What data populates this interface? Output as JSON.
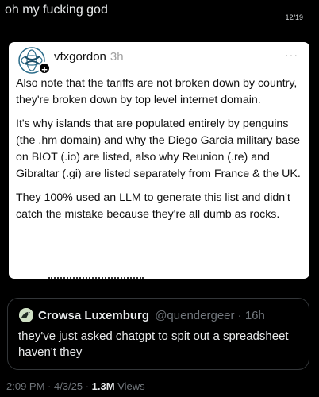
{
  "header": {
    "title": "oh my fucking god",
    "page_counter": "12/19"
  },
  "quoted_post": {
    "username": "vfxgordon",
    "time": "3h",
    "more": "···",
    "avatar_plus": "+",
    "paragraphs": [
      "Also note that the tariffs are not broken down by country, they're broken down by top level internet domain.",
      "It's why islands that are populated entirely by penguins (the .hm domain) and why the Diego Garcia military base on BIOT (.io) are listed, also why Reunion (.re) and Gibraltar (.gi) are listed separately from France & the UK.",
      "They 100% used an LLM to generate this list and didn't catch the mistake because they're all dumb as rocks."
    ]
  },
  "reply": {
    "name": "Crowsa Luxemburg",
    "handle": "@quendergeer · 16h",
    "text": "they've just asked chatgpt to spit out a spreadsheet haven't they"
  },
  "meta": {
    "time": "2:09 PM · 4/3/25 · ",
    "views_count": "1.3M",
    "views_label": " Views"
  }
}
